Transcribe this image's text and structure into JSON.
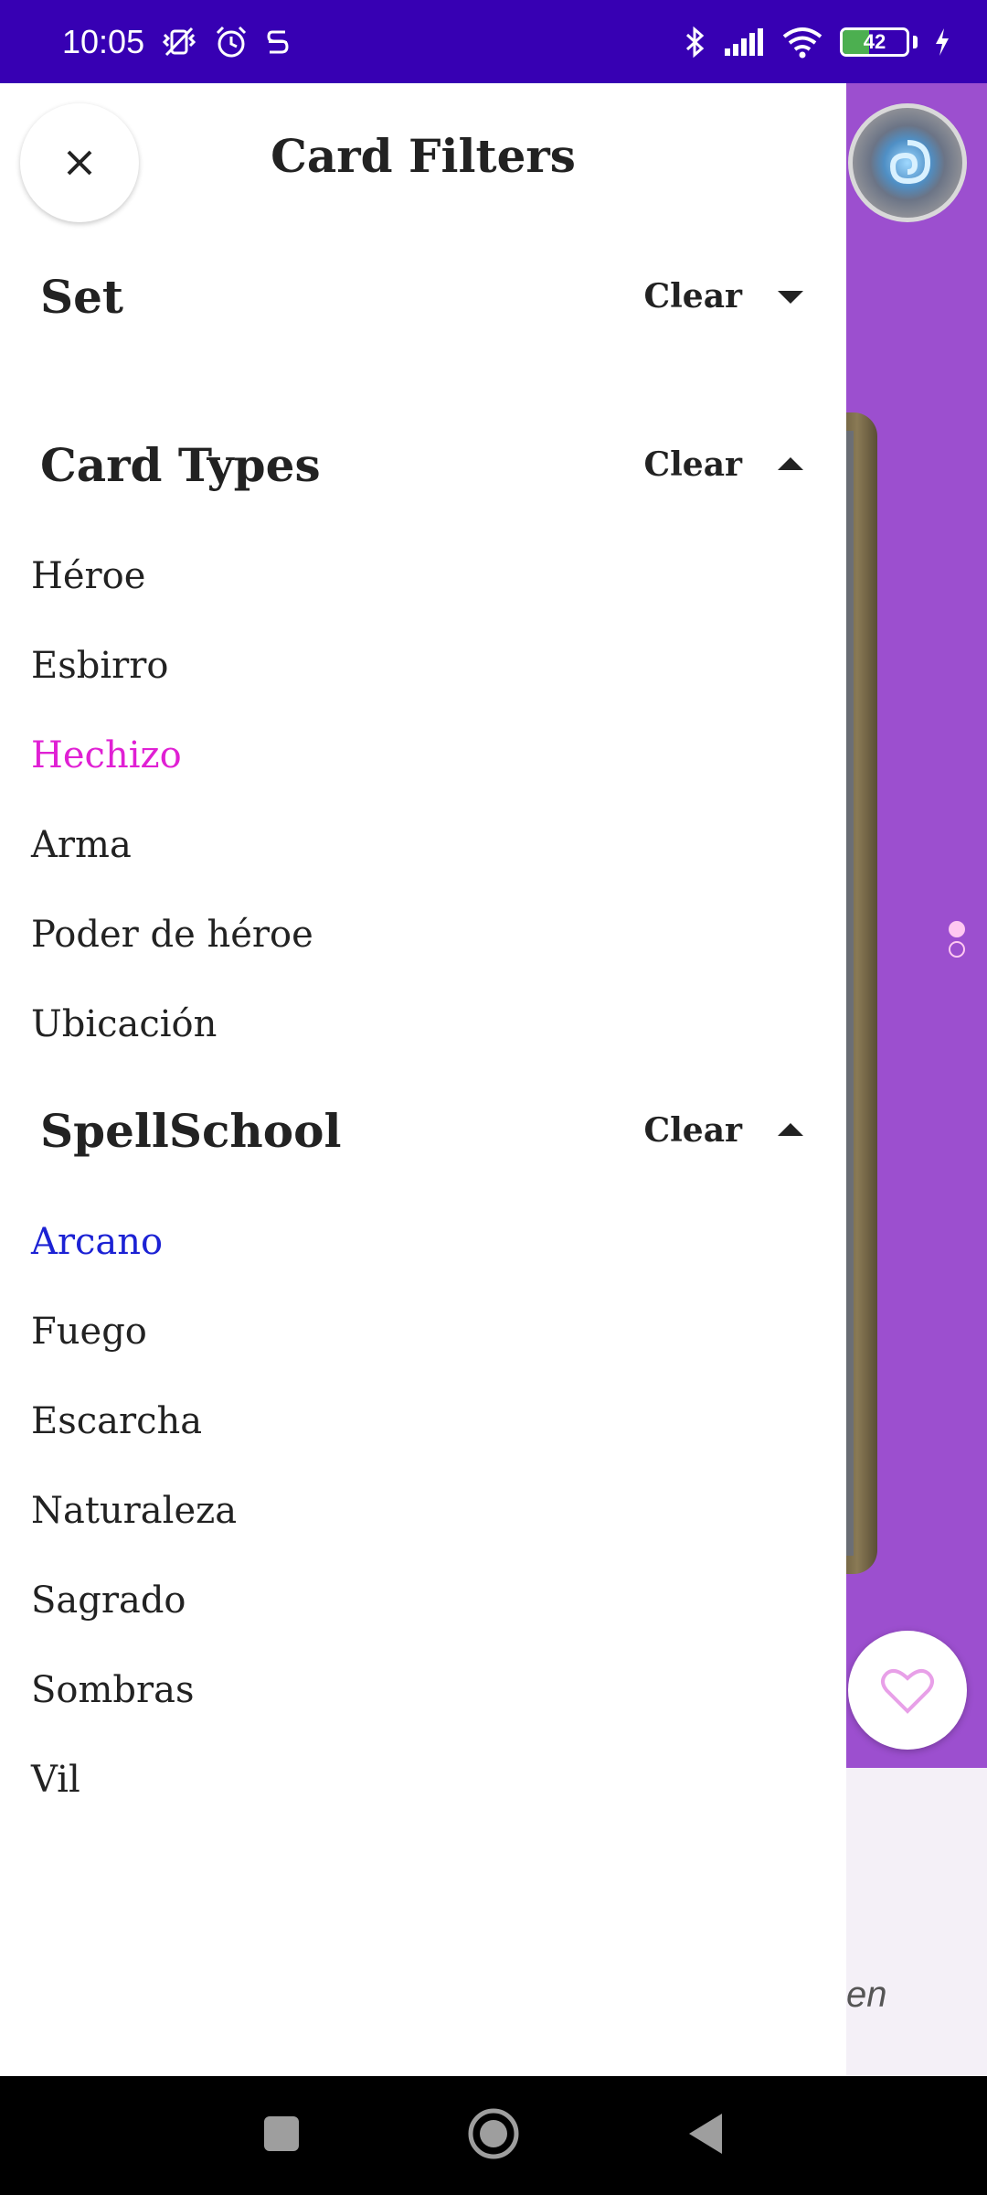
{
  "status_bar": {
    "time": "10:05",
    "battery_percent": 42,
    "battery_label": "42",
    "icons": [
      "vibrate-off-icon",
      "alarm-icon",
      "s-app-icon",
      "bluetooth-icon",
      "signal-icon",
      "wifi-icon",
      "battery-icon",
      "charging-icon"
    ]
  },
  "drawer": {
    "title": "Card Filters",
    "close_icon": "close-icon",
    "sections": {
      "set": {
        "title": "Set",
        "clear_label": "Clear",
        "expanded": false
      },
      "card_types": {
        "title": "Card Types",
        "clear_label": "Clear",
        "expanded": true,
        "options": [
          {
            "label": "Héroe",
            "selected": false
          },
          {
            "label": "Esbirro",
            "selected": false
          },
          {
            "label": "Hechizo",
            "selected": true
          },
          {
            "label": "Arma",
            "selected": false
          },
          {
            "label": "Poder de héroe",
            "selected": false
          },
          {
            "label": "Ubicación",
            "selected": false
          }
        ]
      },
      "spell_school": {
        "title": "SpellSchool",
        "clear_label": "Clear",
        "expanded": true,
        "options": [
          {
            "label": "Arcano",
            "selected": true
          },
          {
            "label": "Fuego",
            "selected": false
          },
          {
            "label": "Escarcha",
            "selected": false
          },
          {
            "label": "Naturaleza",
            "selected": false
          },
          {
            "label": "Sagrado",
            "selected": false
          },
          {
            "label": "Sombras",
            "selected": false
          },
          {
            "label": "Vil",
            "selected": false
          }
        ]
      }
    }
  },
  "background": {
    "partial_text": "en",
    "accent_color": "#9c4fcf",
    "status_color": "#3700b3",
    "selected_pink": "#e020d4",
    "selected_blue": "#1c22d4"
  },
  "nav_bar": {
    "buttons": [
      "recents-button",
      "home-button",
      "back-button"
    ]
  }
}
